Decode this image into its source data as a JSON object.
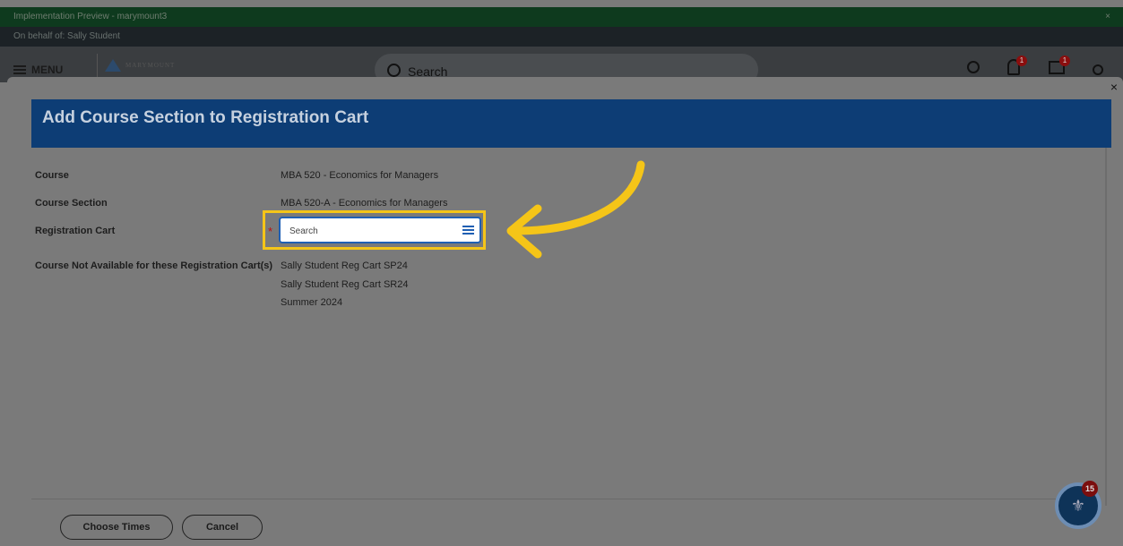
{
  "env": {
    "preview_label": "Implementation Preview - marymount3",
    "behalf_label": "On behalf of: Sally Student"
  },
  "appbar": {
    "menu_label": "MENU",
    "logo_text": "MARYMOUNT",
    "search_label": "Search",
    "notification_count": "1",
    "inbox_count": "1"
  },
  "modal": {
    "title": "Add Course Section to Registration Cart",
    "course_label": "Course",
    "course_value": "MBA 520 - Economics for Managers",
    "section_label": "Course Section",
    "section_value": "MBA 520-A - Economics for Managers",
    "cart_label": "Registration Cart",
    "cart_placeholder": "Search",
    "not_available_label": "Course Not Available for these Registration Cart(s)",
    "not_available_values": [
      "Sally Student Reg Cart SP24",
      "Sally Student Reg Cart SR24",
      "Summer 2024"
    ],
    "buttons": {
      "choose_times": "Choose Times",
      "cancel": "Cancel"
    }
  },
  "helper": {
    "badge": "15"
  },
  "colors": {
    "header_blue": "#0d3d75",
    "highlight": "#f5c518",
    "arrow": "#f5c518",
    "input_border": "#1f5fb3"
  },
  "icons": [
    "menu-icon",
    "search-icon",
    "apps-icon",
    "bell-icon",
    "inbox-icon",
    "user-icon",
    "close-icon",
    "list-icon",
    "arrow-pointer-icon",
    "help-icon"
  ]
}
